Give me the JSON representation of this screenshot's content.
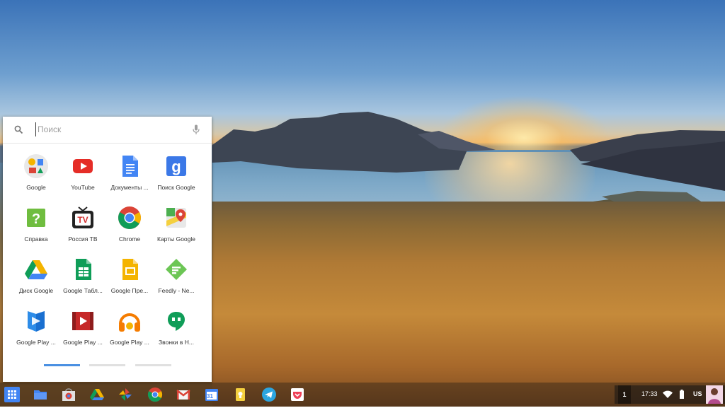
{
  "launcher": {
    "search_placeholder": "Поиск",
    "apps": [
      {
        "label": "Google",
        "icon": "google-search-icon"
      },
      {
        "label": "YouTube",
        "icon": "youtube-icon"
      },
      {
        "label": "Документы ...",
        "icon": "google-docs-icon"
      },
      {
        "label": "Поиск Google",
        "icon": "google-search-g-icon"
      },
      {
        "label": "Справка",
        "icon": "help-icon"
      },
      {
        "label": "Россия ТВ",
        "icon": "russia-tv-icon"
      },
      {
        "label": "Chrome",
        "icon": "chrome-icon"
      },
      {
        "label": "Карты Google",
        "icon": "google-maps-icon"
      },
      {
        "label": "Диск Google",
        "icon": "google-drive-icon"
      },
      {
        "label": "Google Табл...",
        "icon": "google-sheets-icon"
      },
      {
        "label": "Google Пре...",
        "icon": "google-slides-icon"
      },
      {
        "label": "Feedly - Ne...",
        "icon": "feedly-icon"
      },
      {
        "label": "Google Play ...",
        "icon": "google-play-books-icon"
      },
      {
        "label": "Google Play ...",
        "icon": "google-play-movies-icon"
      },
      {
        "label": "Google Play ...",
        "icon": "google-play-music-icon"
      },
      {
        "label": "Звонки в Н...",
        "icon": "hangouts-icon"
      }
    ],
    "page_count": 3,
    "active_page": 1
  },
  "shelf": {
    "items": [
      "app-launcher-icon",
      "files-icon",
      "web-store-icon",
      "google-drive-icon",
      "google-photos-icon",
      "chrome-icon",
      "gmail-icon",
      "calendar-icon",
      "keep-icon",
      "telegram-icon",
      "pocket-icon"
    ],
    "calendar_day": "31"
  },
  "tray": {
    "notification_count": "1",
    "time": "17:33",
    "keyboard_layout": "US"
  },
  "colors": {
    "accent": "#4a90e2",
    "shelf_bg": "#1f1f1f"
  }
}
